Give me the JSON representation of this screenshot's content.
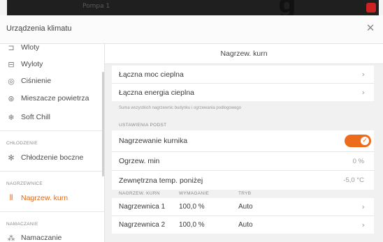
{
  "window": {
    "bg_tab_text": "Pompa 1",
    "title": "Urządzenia klimatu",
    "close_icon": "close-icon"
  },
  "sidebar": {
    "items_top": [
      {
        "label": "Wloty",
        "icon": "inlet-icon"
      },
      {
        "label": "Wyloty",
        "icon": "outlet-icon"
      },
      {
        "label": "Ciśnienie",
        "icon": "pressure-icon"
      },
      {
        "label": "Mieszacze powietrza",
        "icon": "air-mixer-icon"
      },
      {
        "label": "Soft Chill",
        "icon": "soft-chill-icon"
      }
    ],
    "sections": [
      {
        "title": "CHŁODZENIE",
        "items": [
          {
            "label": "Chłodzenie boczne",
            "icon": "snowflake-icon"
          }
        ]
      },
      {
        "title": "NAGRZEWNICE",
        "items": [
          {
            "label": "Nagrzew. kurn",
            "icon": "heater-icon",
            "active": true
          }
        ]
      },
      {
        "title": "NAMACZANIE",
        "items": [
          {
            "label": "Namaczanie",
            "icon": "soaking-icon"
          }
        ]
      }
    ]
  },
  "main": {
    "title": "Nagrzew. kurn",
    "links": [
      {
        "label": "Łączna moc cieplna"
      },
      {
        "label": "Łączna energia cieplna"
      }
    ],
    "note": "Suma wszystkich nagrzewnic budynku i ogrzewania podłogowego",
    "settings": {
      "section_title": "USTAWIENIA PODST",
      "heating_toggle": {
        "label": "Nagrzewanie kurnika",
        "on": true
      },
      "min_heating": {
        "label": "Ogrzew. min",
        "value": "0 %"
      },
      "outside_temp": {
        "label": "Zewnętrzna temp. poniżej",
        "value": "-5,0 °C"
      }
    },
    "table": {
      "headers": [
        "NAGRZEW. KURN",
        "WYMAGANIE",
        "TRYB"
      ],
      "rows": [
        {
          "name": "Nagrzewnica 1",
          "demand": "100,0 %",
          "mode": "Auto"
        },
        {
          "name": "Nagrzewnica 2",
          "demand": "100,0 %",
          "mode": "Auto"
        }
      ]
    }
  },
  "colors": {
    "accent": "#ec6c1c",
    "active_text": "#e06a1c",
    "panel_bg": "#f1f1f1"
  }
}
